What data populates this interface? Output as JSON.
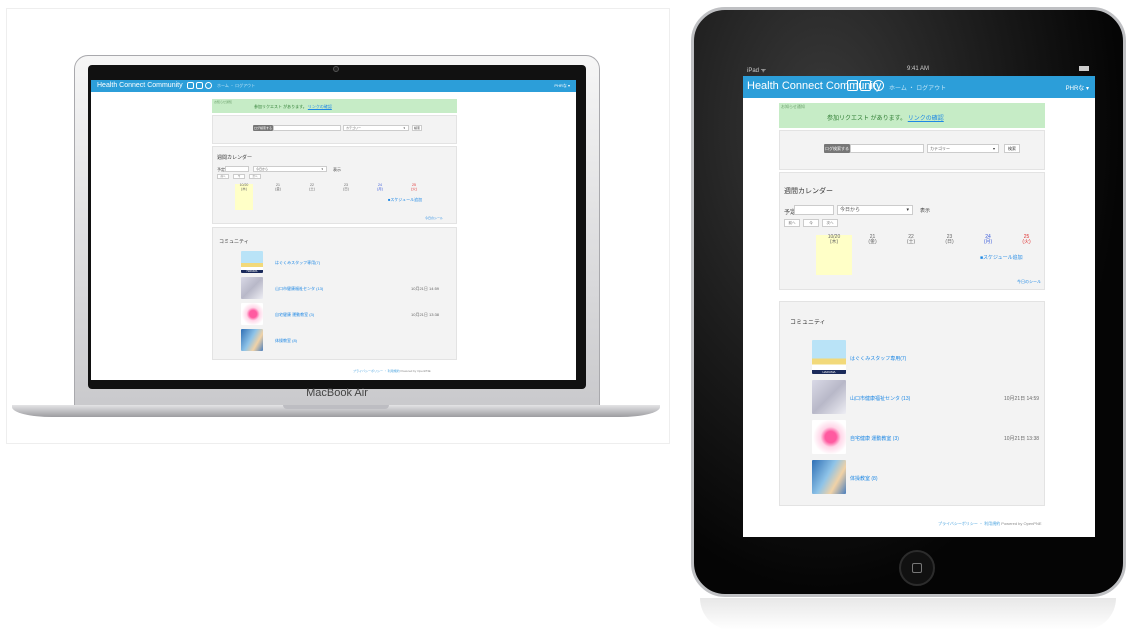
{
  "app": {
    "title": "Health Connect Community",
    "nav_links": "ホーム ・ ログアウト",
    "user_menu": "PHRな ▾"
  },
  "laptop": {
    "brand": "MacBook Air"
  },
  "tablet": {
    "status_left": "iPad ᯤ",
    "status_time": "9:41 AM"
  },
  "notice": {
    "label": "お知らせ通知",
    "message": "参加リクエスト があります。",
    "link": "リンクの確認"
  },
  "search": {
    "button": "ログ検索する",
    "select": "カテゴリー",
    "submit": "検索"
  },
  "calendar": {
    "heading": "週間カレンダー",
    "week_label": "予定",
    "range_select": "今日から",
    "range_submit": "表示",
    "nav": [
      "前へ",
      "今",
      "次へ"
    ],
    "days": [
      {
        "date": "10/20",
        "wd": "(木)",
        "cls": "today"
      },
      {
        "date": "21",
        "wd": "(金)",
        "cls": ""
      },
      {
        "date": "22",
        "wd": "(土)",
        "cls": ""
      },
      {
        "date": "23",
        "wd": "(日)",
        "cls": ""
      },
      {
        "date": "24",
        "wd": "(月)",
        "cls": "sat"
      },
      {
        "date": "25",
        "wd": "(火)",
        "cls": "sun"
      }
    ],
    "add_link": "■スケジュール追加",
    "more_link": "今日のシール"
  },
  "community": {
    "heading": "コミュニティ",
    "items": [
      {
        "title": "はぐくみスタッフ専用(7)",
        "date": "",
        "thumb": "t1",
        "badge": "HARUMA"
      },
      {
        "title": "山口市健康福祉センタ (13)",
        "date": "10月21日 14:59",
        "thumb": "t2",
        "badge": ""
      },
      {
        "title": "自宅健康 運動教室 (3)",
        "date": "10月21日 13:38",
        "thumb": "t3",
        "badge": ""
      },
      {
        "title": "体操教室 (8)",
        "date": "",
        "thumb": "t4",
        "badge": ""
      }
    ]
  },
  "footer": {
    "links": "プライバシーポリシー ・ 利用規約",
    "powered": "Powered by OpenPNE"
  }
}
